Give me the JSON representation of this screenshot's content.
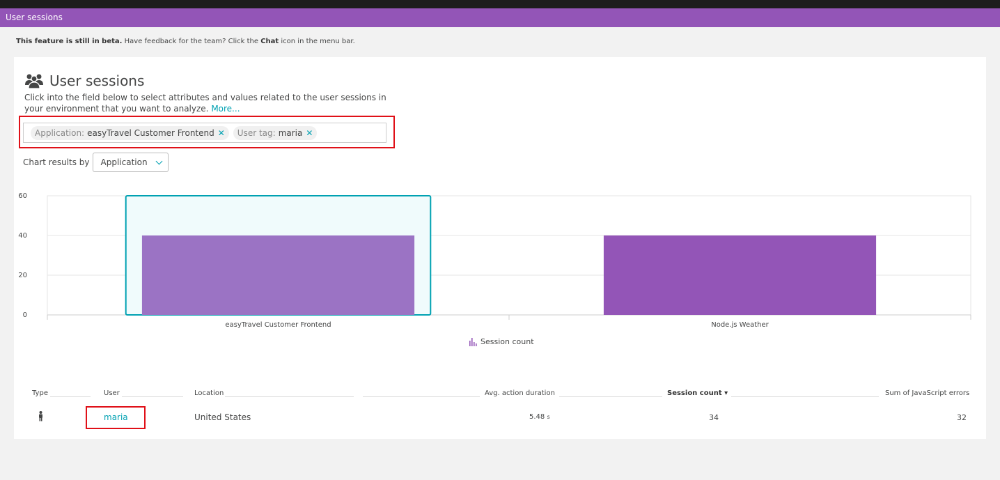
{
  "titlebar": {
    "title": "User sessions"
  },
  "beta": {
    "bold_prefix": "This feature is still in beta.",
    "text1": "Have feedback for the team? Click the",
    "chat_word": "Chat",
    "text2": "icon in the menu bar."
  },
  "header": {
    "title": "User sessions",
    "intro": "Click into the field below to select attributes and values related to the user sessions in your environment that you want to analyze.",
    "more_link": "More..."
  },
  "filter": {
    "chips": [
      {
        "key": "Application:",
        "value": "easyTravel Customer Frontend"
      },
      {
        "key": "User tag:",
        "value": "maria"
      }
    ]
  },
  "chart_by": {
    "label": "Chart results by",
    "selected": "Application"
  },
  "chart_data": {
    "type": "bar",
    "categories": [
      "easyTravel Customer Frontend",
      "Node.js Weather"
    ],
    "series": [
      {
        "name": "Session count",
        "values": [
          40,
          40
        ]
      }
    ],
    "ylim": [
      0,
      60
    ],
    "yticks": [
      0,
      20,
      40,
      60
    ],
    "grid": true,
    "legend": "bottom",
    "selected_category": "easyTravel Customer Frontend",
    "colors": {
      "bar": "#9355b7",
      "bar_selected": "#9b73c4",
      "selection_border": "#00a1b2",
      "selection_fill": "#f0fbfc"
    }
  },
  "table": {
    "headers": {
      "type": "Type",
      "user": "User",
      "location": "Location",
      "avg_action": "Avg. action duration",
      "session_count": "Session count",
      "session_sort": "▾",
      "js_errors": "Sum of JavaScript errors"
    },
    "rows": [
      {
        "user": "maria",
        "location": "United States",
        "avg_action": "5.48",
        "avg_unit": "s",
        "session_count": "34",
        "js_errors": "32"
      }
    ]
  }
}
